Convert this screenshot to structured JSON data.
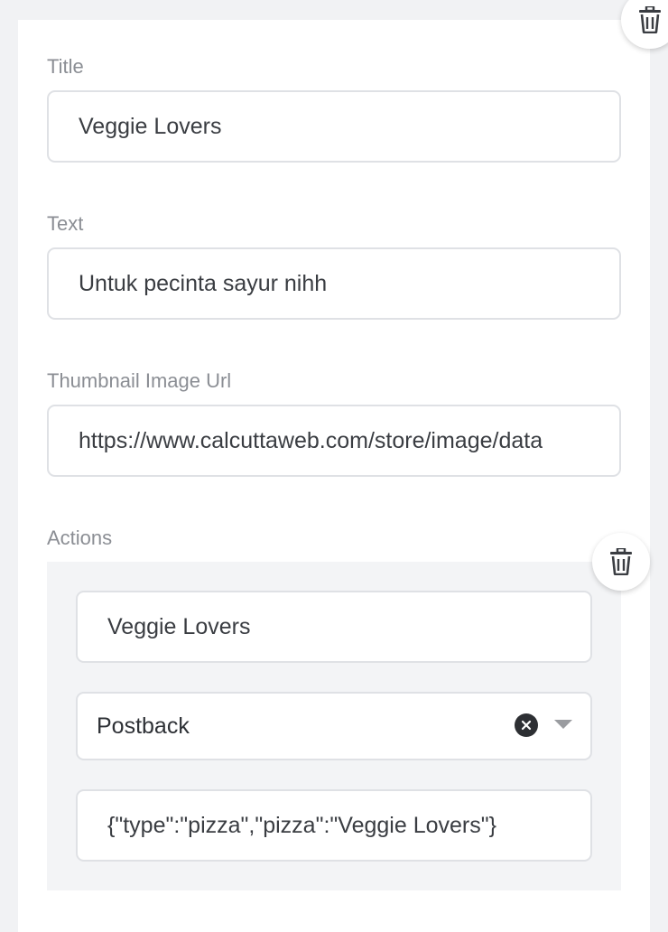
{
  "form": {
    "title": {
      "label": "Title",
      "value": "Veggie Lovers"
    },
    "text": {
      "label": "Text",
      "value": "Untuk pecinta sayur nihh"
    },
    "thumbnail": {
      "label": "Thumbnail Image Url",
      "value": "https://www.calcuttaweb.com/store/image/data"
    },
    "actions": {
      "label": "Actions",
      "items": [
        {
          "label_value": "Veggie Lovers",
          "type_selected": "Postback",
          "payload_value": "{\"type\":\"pizza\",\"pizza\":\"Veggie Lovers\"}"
        }
      ]
    }
  },
  "icons": {
    "delete_card": "trash-icon",
    "delete_action": "trash-icon",
    "clear_select": "close-circle-icon",
    "select_caret": "chevron-down-icon"
  }
}
